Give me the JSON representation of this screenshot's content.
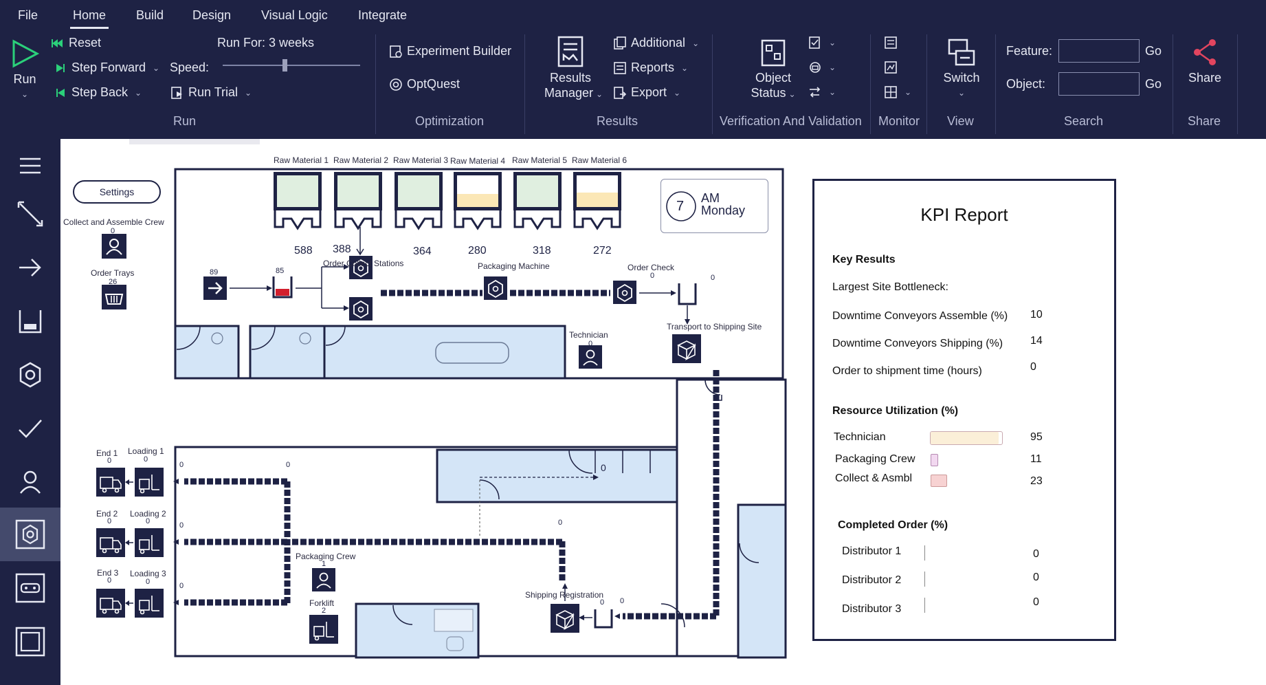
{
  "menu": {
    "file": "File",
    "home": "Home",
    "build": "Build",
    "design": "Design",
    "visual_logic": "Visual Logic",
    "integrate": "Integrate"
  },
  "run_group": {
    "run_label": "Run",
    "reset": "Reset",
    "step_forward": "Step Forward",
    "step_back": "Step Back",
    "run_for": "Run For: 3 weeks",
    "speed": "Speed:",
    "speed_level": 0.45,
    "run_trial": "Run Trial",
    "group_label": "Run"
  },
  "optimization_group": {
    "experiment_builder": "Experiment Builder",
    "optquest": "OptQuest",
    "group_label": "Optimization"
  },
  "results_group": {
    "results_manager_l1": "Results",
    "results_manager_l2": "Manager",
    "additional": "Additional",
    "reports": "Reports",
    "export": "Export",
    "group_label": "Results"
  },
  "verification_group": {
    "object_status_l1": "Object",
    "object_status_l2": "Status",
    "group_label": "Verification And Validation"
  },
  "monitor_group": {
    "group_label": "Monitor"
  },
  "view_group": {
    "switch": "Switch",
    "group_label": "View"
  },
  "search_group": {
    "feature_label": "Feature:",
    "object_label": "Object:",
    "go": "Go",
    "feature_value": "",
    "object_value": "",
    "group_label": "Search"
  },
  "share_group": {
    "share": "Share",
    "group_label": "Share"
  },
  "colors": {
    "dark_navy": "#1e2244",
    "room_blue": "#d4e5f7",
    "hopper_green": "#e0efe0",
    "hopper_yellow": "#fbe7b6",
    "buffer_red": "#d21f2d"
  },
  "canvas": {
    "settings": "Settings",
    "collect_crew": "Collect and Assemble Crew",
    "collect_crew_count": "0",
    "order_trays": "Order Trays",
    "order_trays_count": "26",
    "raw_materials": [
      {
        "label": "Raw Material 1",
        "value": "588",
        "fill": "green"
      },
      {
        "label": "Raw Material 2",
        "value": "388",
        "fill": "green"
      },
      {
        "label": "Raw Material 3",
        "value": "364",
        "fill": "green"
      },
      {
        "label": "Raw Material 4",
        "value": "280",
        "fill": "yellow"
      },
      {
        "label": "Raw Material 5",
        "value": "318",
        "fill": "green"
      },
      {
        "label": "Raw Material 6",
        "value": "272",
        "fill": "yellow"
      }
    ],
    "arrival_count": "89",
    "buffer_count": "85",
    "order_collect_stations": "Order Collect Stations",
    "packaging_machine": "Packaging Machine",
    "order_check": "Order Check",
    "order_check_count": "0",
    "queue_count": "0",
    "technician": "Technician",
    "technician_count": "0",
    "transport": "Transport to Shipping Site",
    "clock_ampm": "AM",
    "clock_day": "Monday",
    "clock_hour": "7",
    "shelf_count": "0",
    "ends": [
      {
        "end": "End 1",
        "end_count": "0",
        "loading": "Loading 1",
        "loading_count": "0"
      },
      {
        "end": "End 2",
        "end_count": "0",
        "loading": "Loading 2",
        "loading_count": "0"
      },
      {
        "end": "End 3",
        "end_count": "0",
        "loading": "Loading 3",
        "loading_count": "0"
      }
    ],
    "conv_counts": {
      "c1a": "0",
      "c1b": "0",
      "c2": "0",
      "c3": "0",
      "c4": "0",
      "reg1": "0",
      "reg2": "0"
    },
    "packaging_crew": "Packaging Crew",
    "packaging_crew_count": "1",
    "forklift": "Forklift",
    "forklift_count": "2",
    "shipping_registration": "Shipping Registration"
  },
  "kpi": {
    "title": "KPI Report",
    "key_results": "Key Results",
    "largest_bottleneck": "Largest Site Bottleneck:",
    "downtime_assemble": "Downtime Conveyors Assemble (%)",
    "downtime_assemble_val": "10",
    "downtime_shipping": "Downtime Conveyors Shipping (%)",
    "downtime_shipping_val": "14",
    "order_to_ship": "Order to shipment time (hours)",
    "order_to_ship_val": "0",
    "resource_util": "Resource Utilization (%)",
    "resources": [
      {
        "name": "Technician",
        "value": "95",
        "level": 0.95,
        "color": "#fbefd8"
      },
      {
        "name": "Packaging Crew",
        "value": "11",
        "level": 0.11,
        "color": "#f2d8f0"
      },
      {
        "name": "Collect & Asmbl",
        "value": "23",
        "level": 0.23,
        "color": "#f7d2d2"
      }
    ],
    "completed_order": "Completed Order (%)",
    "distributors": [
      {
        "name": "Distributor 1",
        "value": "0"
      },
      {
        "name": "Distributor 2",
        "value": "0"
      },
      {
        "name": "Distributor 3",
        "value": "0"
      }
    ]
  }
}
